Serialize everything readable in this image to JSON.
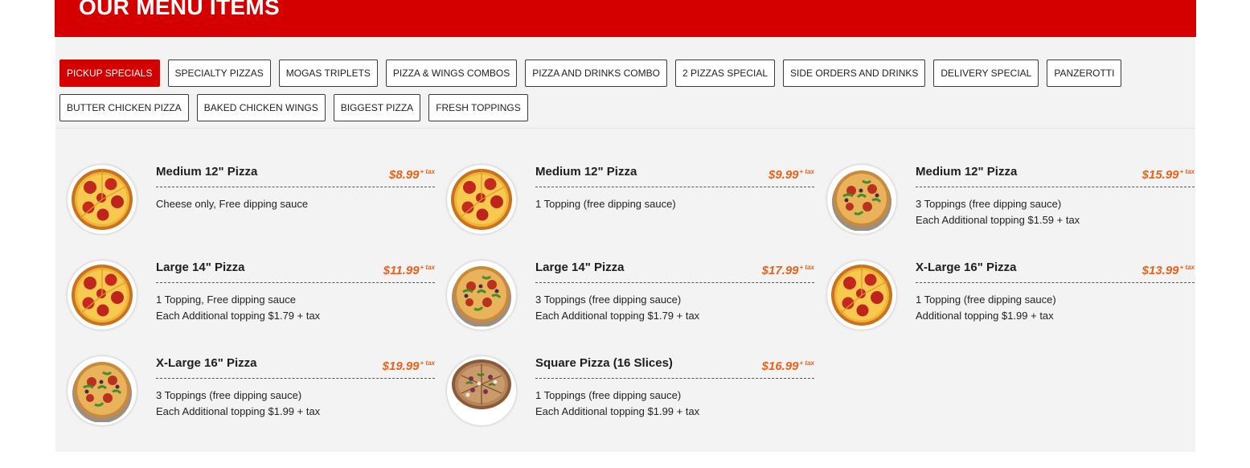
{
  "header": {
    "title": "OUR MENU ITEMS"
  },
  "tabs": [
    [
      {
        "label": "PICKUP SPECIALS",
        "active": true
      },
      {
        "label": "SPECIALTY PIZZAS"
      },
      {
        "label": "MOGAS TRIPLETS"
      },
      {
        "label": "PIZZA & WINGS COMBOS"
      },
      {
        "label": "PIZZA AND DRINKS COMBO"
      },
      {
        "label": "2 PIZZAS SPECIAL"
      },
      {
        "label": "SIDE ORDERS AND DRINKS"
      },
      {
        "label": "DELIVERY SPECIAL"
      },
      {
        "label": "PANZEROTTI"
      }
    ],
    [
      {
        "label": "BUTTER CHICKEN PIZZA"
      },
      {
        "label": "BAKED CHICKEN WINGS"
      },
      {
        "label": "BIGGEST PIZZA"
      },
      {
        "label": "FRESH TOPPINGS"
      }
    ]
  ],
  "tax_label": "+ tax",
  "colors": {
    "brand": "#d40000",
    "price": "#e8621a"
  },
  "items": [
    {
      "name": "Medium 12\" Pizza",
      "price": "$8.99",
      "lines": [
        "Cheese only, Free dipping sauce"
      ],
      "image": "pepperoni-pizza-image"
    },
    {
      "name": "Medium 12\" Pizza",
      "price": "$9.99",
      "lines": [
        "1 Topping (free dipping sauce)"
      ],
      "image": "pepperoni-pizza-image"
    },
    {
      "name": "Medium 12\" Pizza",
      "price": "$15.99",
      "lines": [
        "3 Toppings (free dipping sauce)",
        "Each Additional topping $1.59 + tax"
      ],
      "image": "veggie-pizza-image"
    },
    {
      "name": "Large 14\" Pizza",
      "price": "$11.99",
      "lines": [
        "1 Topping, Free dipping sauce",
        "Each Additional topping $1.79 + tax"
      ],
      "image": "pepperoni-pizza-image"
    },
    {
      "name": "Large 14\" Pizza",
      "price": "$17.99",
      "lines": [
        "3 Toppings (free dipping sauce)",
        "Each Additional topping $1.79 + tax"
      ],
      "image": "veggie-pizza-image"
    },
    {
      "name": "X-Large 16\" Pizza",
      "price": "$13.99",
      "lines": [
        "1 Topping (free dipping sauce)",
        "Additional topping $1.99 + tax"
      ],
      "image": "pepperoni-pizza-image"
    },
    {
      "name": "X-Large 16\" Pizza",
      "price": "$19.99",
      "lines": [
        "3 Toppings (free dipping sauce)",
        "Each Additional topping $1.99 + tax"
      ],
      "image": "veggie-pizza-image"
    },
    {
      "name": "Square Pizza (16 Slices)",
      "price": "$16.99",
      "lines": [
        "1 Toppings (free dipping sauce)",
        "Each Additional topping $1.99 + tax"
      ],
      "image": "square-pizza-image"
    }
  ]
}
